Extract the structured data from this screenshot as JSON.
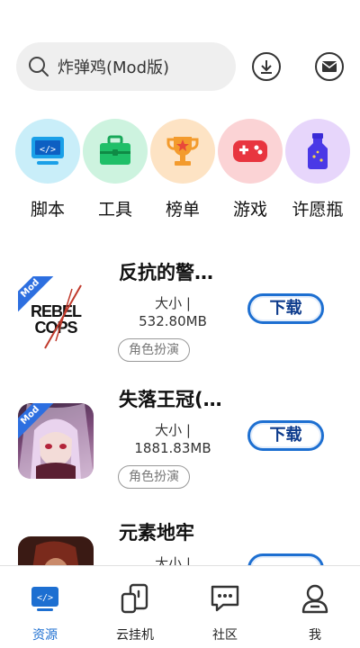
{
  "search": {
    "placeholder": "炸弹鸡(Mod版)"
  },
  "header": {
    "download_icon": "download-icon",
    "mail_icon": "mail-icon"
  },
  "categories": [
    {
      "label": "脚本",
      "icon": "code-monitor-icon",
      "bg": "#c9eef9"
    },
    {
      "label": "工具",
      "icon": "toolbox-icon",
      "bg": "#cdf3df"
    },
    {
      "label": "榜单",
      "icon": "trophy-icon",
      "bg": "#fde3c4"
    },
    {
      "label": "游戏",
      "icon": "gamepad-icon",
      "bg": "#fbd3d5"
    },
    {
      "label": "许愿瓶",
      "icon": "bottle-icon",
      "bg": "#e7d6fb"
    }
  ],
  "apps": [
    {
      "title": "反抗的警…",
      "size_label": "大小 |",
      "size_value": "532.80MB",
      "tag": "角色扮演",
      "download": "下载",
      "badge": "Mod",
      "logo_line1": "REBEL",
      "logo_line2": "COPS"
    },
    {
      "title": "失落王冠(…",
      "size_label": "大小 |",
      "size_value": "1881.83MB",
      "tag": "角色扮演",
      "download": "下载",
      "badge": "Mod"
    },
    {
      "title": "元素地牢",
      "size_label": "大小 |",
      "size_value": "",
      "tag": "",
      "download": ""
    }
  ],
  "nav": [
    {
      "label": "资源",
      "active": true
    },
    {
      "label": "云挂机",
      "active": false
    },
    {
      "label": "社区",
      "active": false
    },
    {
      "label": "我",
      "active": false
    }
  ],
  "colors": {
    "accent": "#1d6fd1",
    "download_text": "#0d3b8c",
    "search_bg": "#efefef"
  }
}
